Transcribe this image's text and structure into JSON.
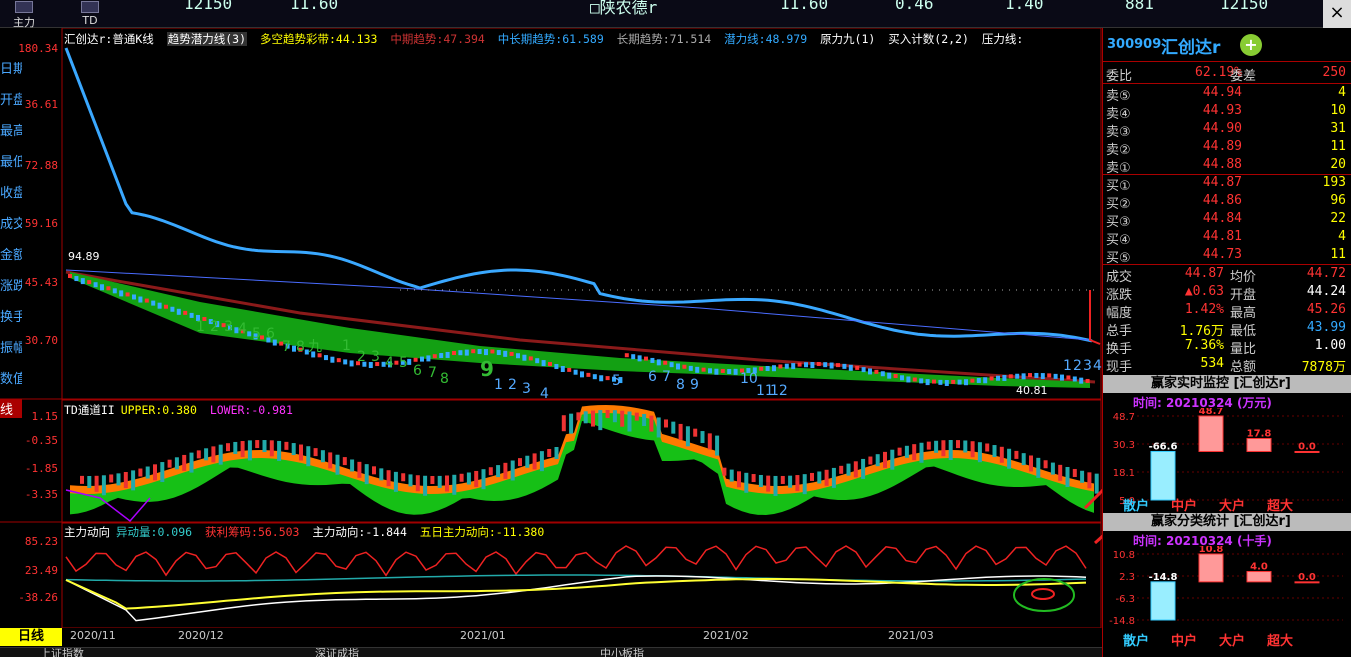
{
  "topbar": {
    "buttons": [
      {
        "label": "主力"
      },
      {
        "label": "TD"
      }
    ],
    "values": [
      "12150",
      "11.60",
      "□陕农德r",
      "11.60",
      "0.46",
      "1.40",
      "881",
      "12150"
    ],
    "close_glyph": "×"
  },
  "leftbar": {
    "items": [
      "日期",
      "开盘",
      "最高",
      "最低",
      "收盘",
      "成交",
      "金额",
      "涨跌",
      "换手",
      "振幅",
      "数值",
      "线"
    ]
  },
  "main_chart": {
    "legend": {
      "stock": "汇创达r:",
      "ktype": "普通K线",
      "trend_potential": "趋势潜力线(3)",
      "long_short": "多空趋势彩带:",
      "long_short_val": "44.133",
      "mid_trend": "中期趋势:",
      "mid_trend_val": "47.394",
      "midlong_trend": "中长期趋势:",
      "midlong_trend_val": "61.589",
      "long_trend": "长期趋势:",
      "long_trend_val": "71.514",
      "potential": "潜力线:",
      "potential_val": "48.979",
      "yuanli": "原力九(1)",
      "buy_count": "买入计数(2,2)",
      "pressure": "压力线:"
    },
    "y_labels": [
      "180.34",
      "36.61",
      "72.88",
      "59.16",
      "45.43",
      "30.70"
    ],
    "high_marker": "94.89",
    "low_marker": "40.81",
    "td_counts": [
      "1",
      "2",
      "3",
      "4",
      "5",
      "6",
      "7",
      "8",
      "九",
      "1",
      "2",
      "3",
      "4",
      "5",
      "6",
      "7",
      "8",
      "9",
      "1",
      "2",
      "3",
      "4",
      "5",
      "6",
      "7",
      "8",
      "9",
      "10",
      "11",
      "12",
      "1",
      "2",
      "3",
      "4"
    ]
  },
  "td_channel": {
    "legend": {
      "name": "TD通道II",
      "upper_label": "UPPER:",
      "upper_val": "0.380",
      "lower_label": "LOWER:",
      "lower_val": "-0.981"
    },
    "y_labels": [
      "1.15",
      "-0.35",
      "-1.85",
      "-3.35"
    ]
  },
  "main_force": {
    "legend": {
      "name": "主力动向",
      "abnormal_label": "异动量:",
      "abnormal_val": "0.096",
      "profit_label": "获利筹码:",
      "profit_val": "56.503",
      "mf_label": "主力动向:",
      "mf_val": "-1.844",
      "five_label": "五日主力动向:",
      "five_val": "-11.380"
    },
    "y_labels": [
      "85.23",
      "23.49",
      "-38.26"
    ]
  },
  "x_axis": {
    "tab": "日线",
    "dates": [
      "2020/11",
      "2020/12",
      "2021/01",
      "2021/02",
      "2021/03"
    ]
  },
  "right_panel": {
    "code": "300909",
    "name": "汇创达r",
    "plus": "+",
    "weibi_label": "委比",
    "weibi_val": "62.19%",
    "weicha_label": "委差",
    "weicha_val": "250",
    "sell": [
      {
        "label": "卖⑤",
        "price": "44.94",
        "vol": "4"
      },
      {
        "label": "卖④",
        "price": "44.93",
        "vol": "10"
      },
      {
        "label": "卖③",
        "price": "44.90",
        "vol": "31"
      },
      {
        "label": "卖②",
        "price": "44.89",
        "vol": "11"
      },
      {
        "label": "卖①",
        "price": "44.88",
        "vol": "20"
      }
    ],
    "buy": [
      {
        "label": "买①",
        "price": "44.87",
        "vol": "193"
      },
      {
        "label": "买②",
        "price": "44.86",
        "vol": "96"
      },
      {
        "label": "买③",
        "price": "44.84",
        "vol": "22"
      },
      {
        "label": "买④",
        "price": "44.81",
        "vol": "4"
      },
      {
        "label": "买⑤",
        "price": "44.73",
        "vol": "11"
      }
    ],
    "stats": [
      {
        "k1": "成交",
        "v1": "44.87",
        "c1": "#f33",
        "k2": "均价",
        "v2": "44.72",
        "c2": "#f33"
      },
      {
        "k1": "涨跌",
        "v1": "▲0.63",
        "c1": "#f33",
        "k2": "开盘",
        "v2": "44.24",
        "c2": "#fff"
      },
      {
        "k1": "幅度",
        "v1": "1.42%",
        "c1": "#f33",
        "k2": "最高",
        "v2": "45.26",
        "c2": "#f33"
      },
      {
        "k1": "总手",
        "v1": "1.76万",
        "c1": "#ff0",
        "k2": "最低",
        "v2": "43.99",
        "c2": "#3af"
      },
      {
        "k1": "换手",
        "v1": "7.36%",
        "c1": "#ff0",
        "k2": "量比",
        "v2": "1.00",
        "c2": "#fff"
      },
      {
        "k1": "现手",
        "v1": "534",
        "c1": "#ff0",
        "k2": "总额",
        "v2": "7878万",
        "c2": "#ff0"
      }
    ],
    "monitor1": {
      "title": "赢家实时监控 [汇创达r]",
      "sub": "时间: 20210324 (万元)",
      "y_labels": [
        "48.7",
        "30.3",
        "18.1",
        "5.0"
      ],
      "bars": [
        {
          "cat": "散户",
          "value": -66.6,
          "label": "-66.6"
        },
        {
          "cat": "中户",
          "value": 48.7,
          "label": "48.7"
        },
        {
          "cat": "大户",
          "value": 17.8,
          "label": "17.8"
        },
        {
          "cat": "超大",
          "value": 0.0,
          "label": "0.0"
        }
      ]
    },
    "monitor2": {
      "title": "赢家分类统计 [汇创达r]",
      "sub": "时间: 20210324 (十手)",
      "y_labels": [
        "10.8",
        "2.3",
        "-6.3",
        "-14.8"
      ],
      "bars": [
        {
          "cat": "散户",
          "value": -14.8,
          "label": "-14.8"
        },
        {
          "cat": "中户",
          "value": 10.8,
          "label": "10.8"
        },
        {
          "cat": "大户",
          "value": 4.0,
          "label": "4.0"
        },
        {
          "cat": "超大",
          "value": 0.0,
          "label": "0.0"
        }
      ]
    }
  },
  "statusbar": {
    "items": [
      "上证指数",
      "深证成指",
      "中小板指"
    ]
  },
  "colors": {
    "up": "#ff3333",
    "down": "#33aaff",
    "potential": "#3aa8ff",
    "long_trend": "#8b1a1a",
    "green_band": "#13a013",
    "orange_band": "#ff7a00"
  }
}
